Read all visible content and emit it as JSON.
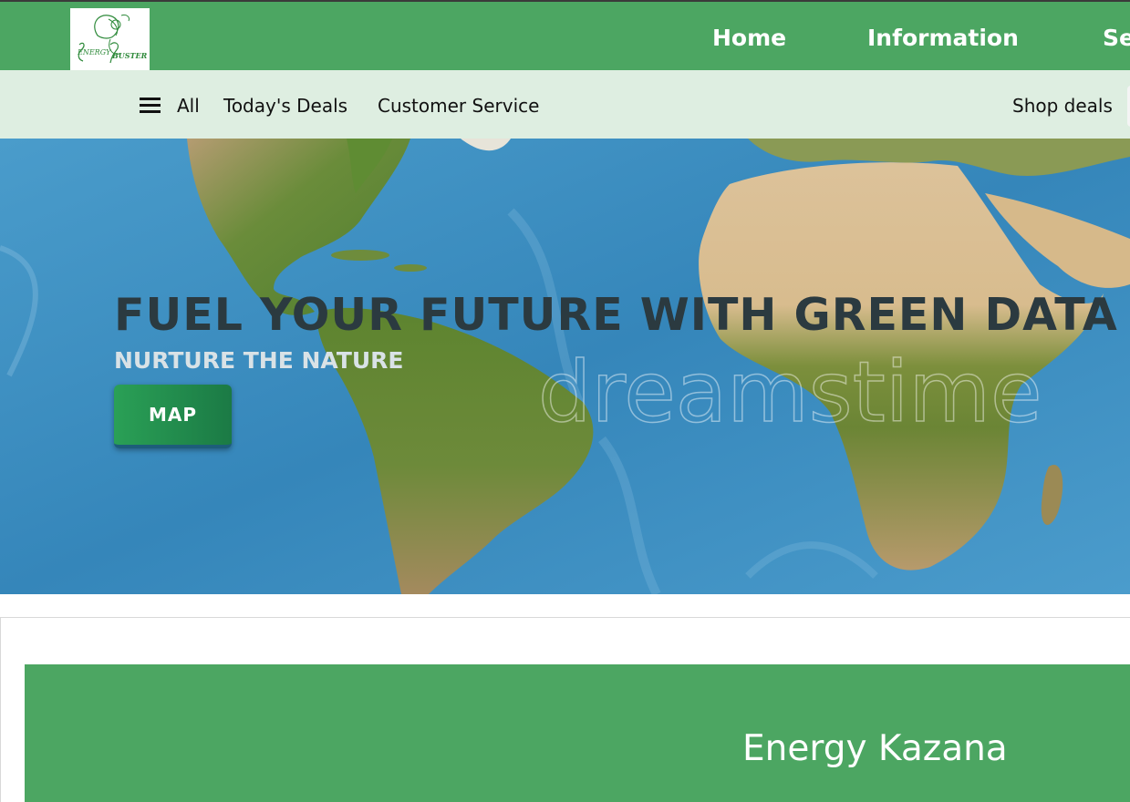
{
  "header": {
    "logo_text_1": "ENERGY",
    "logo_text_2": "BUSTER",
    "nav": [
      "Home",
      "Information",
      "Se"
    ]
  },
  "subnav": {
    "menu_label": "All",
    "links": [
      "Today's Deals",
      "Customer Service"
    ],
    "right_link": "Shop deals"
  },
  "hero": {
    "title": "FUEL YOUR FUTURE WITH GREEN DATA",
    "subtitle": "NURTURE THE NATURE",
    "button_label": "MAP",
    "watermark": "dreamstime"
  },
  "panel": {
    "title": "Energy Kazana"
  },
  "colors": {
    "brand_green": "#4ca662",
    "subbar_bg": "#deeee1",
    "ocean": "#3b8fc0",
    "button_green": "#2aa056"
  },
  "icons": [
    "hamburger-menu-icon",
    "energy-buster-logo"
  ]
}
